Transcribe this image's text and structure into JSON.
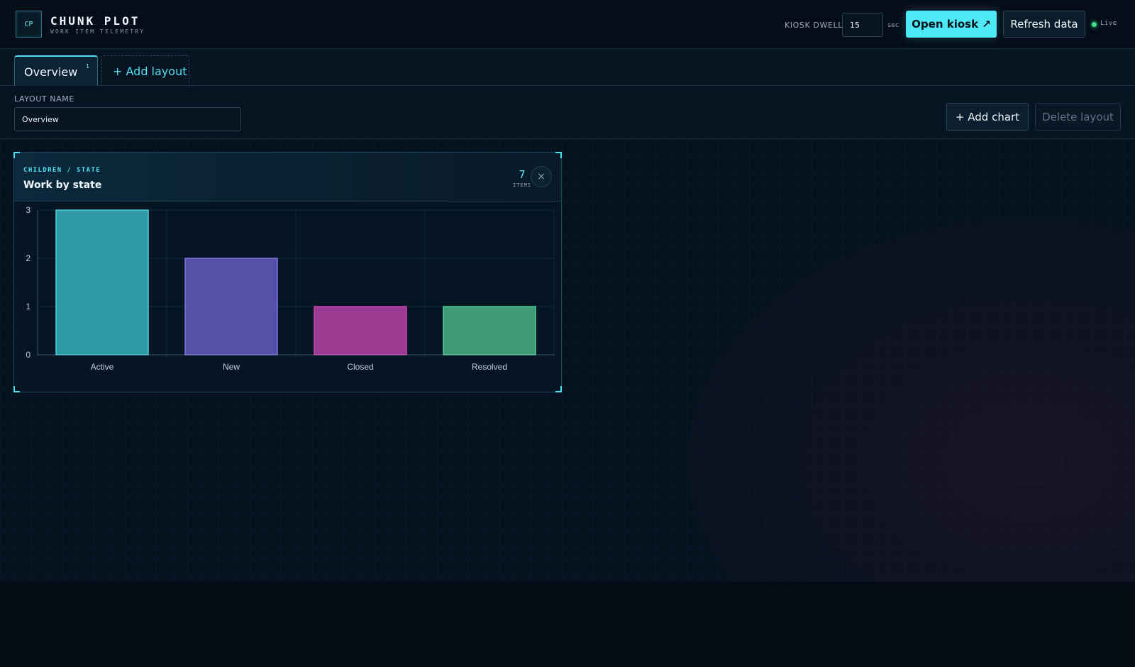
{
  "header": {
    "logo_text": "CP",
    "brand_name": "CHUNK PLOT",
    "brand_subtitle": "WORK ITEM TELEMETRY",
    "kiosk_label": "KIOSK DWELL",
    "kiosk_value": "15",
    "kiosk_unit": "sec",
    "open_kiosk_label": "Open kiosk ↗",
    "refresh_label": "Refresh data",
    "status_label": "Live",
    "status_color": "#3fe08a"
  },
  "tabs": [
    {
      "label": "Overview",
      "count": "1",
      "active": true
    }
  ],
  "add_layout_label": "+ Add layout",
  "editor": {
    "layout_name_label": "LAYOUT NAME",
    "layout_name_value": "Overview",
    "add_chart_label": "+ Add chart",
    "delete_layout_label": "Delete layout"
  },
  "card": {
    "eyebrow": "CHILDREN / STATE",
    "title": "Work by state",
    "count": "7",
    "count_label": "ITEMS",
    "close_icon": "×"
  },
  "chart_data": {
    "type": "bar",
    "title": "Work by state",
    "categories": [
      "Active",
      "New",
      "Closed",
      "Resolved"
    ],
    "values": [
      3,
      2,
      1,
      1
    ],
    "colors": [
      "#3099a6",
      "#5650a8",
      "#9a3a90",
      "#3f9a78"
    ],
    "stroke_colors": [
      "#52e6f2",
      "#8a80f2",
      "#e04cc8",
      "#59e3a6"
    ],
    "y_ticks": [
      0,
      1,
      2,
      3
    ],
    "ylim": [
      0,
      3
    ],
    "grid": true,
    "accent": "#4fe3f2"
  }
}
